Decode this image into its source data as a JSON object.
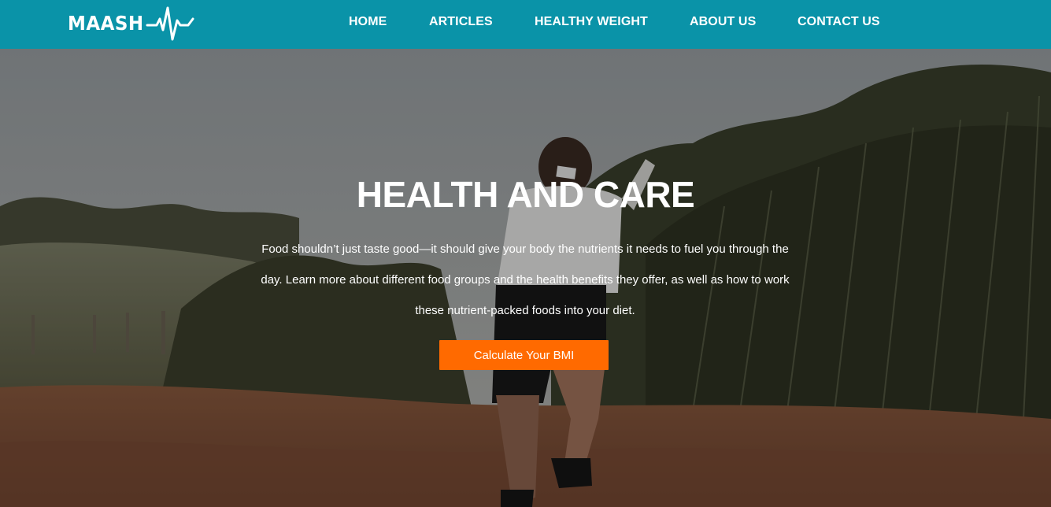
{
  "brand": {
    "logo_text": "MAASH",
    "logo_icon": "heartbeat-pulse-icon"
  },
  "nav": {
    "items": [
      {
        "label": "HOME"
      },
      {
        "label": "ARTICLES"
      },
      {
        "label": "HEALTHY WEIGHT"
      },
      {
        "label": "ABOUT US"
      },
      {
        "label": "CONTACT US"
      }
    ]
  },
  "hero": {
    "title": "HEALTH AND CARE",
    "description": "Food shouldn’t just taste good—it should give your body the nutrients it needs to fuel you through the day. Learn more about different food groups and the health benefits they offer, as well as how to work these nutrient-packed foods into your diet.",
    "cta_label": "Calculate Your BMI"
  },
  "colors": {
    "header_bg": "#0a93a8",
    "cta_bg": "#ff6a00",
    "text": "#ffffff"
  }
}
